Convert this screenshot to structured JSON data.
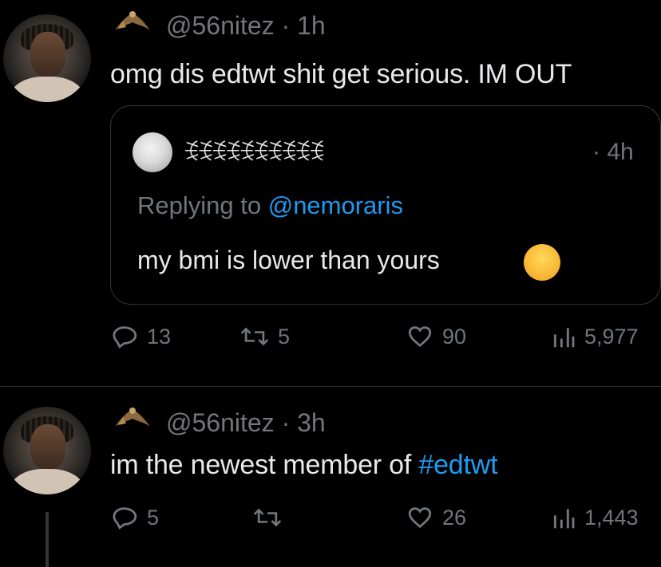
{
  "tweet1": {
    "handle": "@56nitez",
    "separator": "·",
    "time": "1h",
    "text": "omg dis edtwt shit get serious. IM OUT",
    "quote": {
      "display_name": "ꉂꉂꉂꉂꉂꉂꉂꉂꉂꉂ",
      "separator": "·",
      "time": "4h",
      "replying_label": "Replying to",
      "replying_mention": "@nemoraris",
      "text": "my bmi is lower than yours",
      "emoji": "😭"
    },
    "actions": {
      "replies": "13",
      "retweets": "5",
      "likes": "90",
      "views": "5,977"
    }
  },
  "tweet2": {
    "handle": "@56nitez",
    "separator": "·",
    "time": "3h",
    "text_prefix": "im the newest member of ",
    "hashtag": "#edtwt",
    "actions": {
      "replies": "5",
      "retweets": "",
      "likes": "26",
      "views": "1,443"
    }
  },
  "colors": {
    "background": "#000000",
    "text": "#e7e9ea",
    "muted": "#71767b",
    "link": "#1d9bf0",
    "border": "#333639"
  },
  "icons": [
    "bat-flag-icon",
    "reply-icon",
    "retweet-icon",
    "like-icon",
    "views-icon"
  ]
}
